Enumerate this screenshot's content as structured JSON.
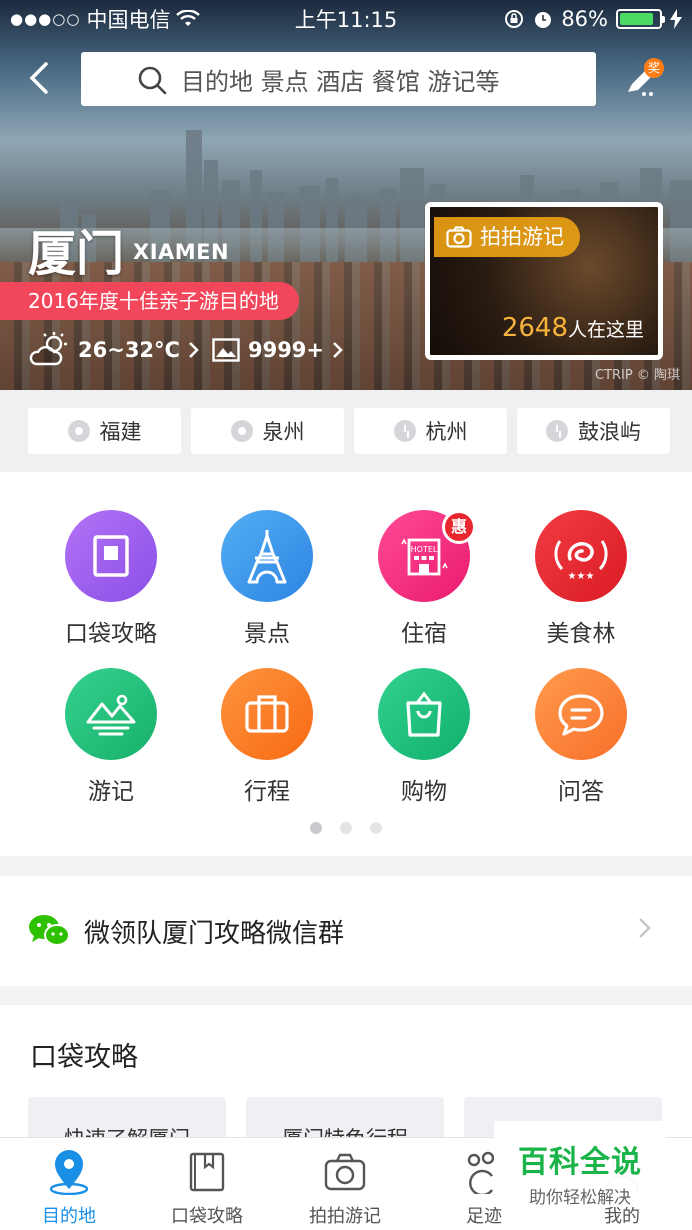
{
  "status_bar": {
    "signal": "●●●○○",
    "carrier": "中国电信",
    "time": "上午11:15",
    "battery": "86%",
    "battery_level": 0.86
  },
  "nav": {
    "search_placeholder": "目的地 景点 酒店 餐馆 游记等",
    "write_badge": "奖"
  },
  "hero": {
    "city_cn": "厦门",
    "city_en": "XIAMEN",
    "award": "2016年度十佳亲子游目的地",
    "weather": "26~32°C",
    "photo_count": "9999+",
    "copyright": "CTRIP © 陶琪",
    "photo_card": {
      "tag": "拍拍游记",
      "count": "2648",
      "count_suffix": "人在这里"
    }
  },
  "chips": [
    {
      "label": "福建",
      "icon": "pin-icon"
    },
    {
      "label": "泉州",
      "icon": "pin-icon"
    },
    {
      "label": "杭州",
      "icon": "clock-icon"
    },
    {
      "label": "鼓浪屿",
      "icon": "clock-icon"
    }
  ],
  "grid": [
    {
      "label": "口袋攻略",
      "icon": "book-icon",
      "color": "#9a5ef0"
    },
    {
      "label": "景点",
      "icon": "tower-icon",
      "color": "#3a96ea"
    },
    {
      "label": "住宿",
      "icon": "hotel-icon",
      "color": "#f42a7a",
      "badge": "惠"
    },
    {
      "label": "美食林",
      "icon": "food-forest-icon",
      "color": "#e82631"
    },
    {
      "label": "游记",
      "icon": "mountain-icon",
      "color": "#22c07a"
    },
    {
      "label": "行程",
      "icon": "suitcase-icon",
      "color": "#fb7a1e"
    },
    {
      "label": "购物",
      "icon": "bag-icon",
      "color": "#1fc07f"
    },
    {
      "label": "问答",
      "icon": "chat-icon",
      "color": "#fb7a2a"
    }
  ],
  "pager": {
    "pages": 3,
    "current": 1
  },
  "wechat_row": {
    "label": "微领队厦门攻略微信群"
  },
  "guide": {
    "title": "口袋攻略",
    "cards": [
      "快速了解厦门",
      "厦门特色行程",
      ""
    ]
  },
  "tabbar": [
    {
      "label": "目的地",
      "icon": "location-icon",
      "active": true
    },
    {
      "label": "口袋攻略",
      "icon": "book-icon",
      "active": false
    },
    {
      "label": "拍拍游记",
      "icon": "camera-icon",
      "active": false
    },
    {
      "label": "足迹",
      "icon": "footprint-icon",
      "active": false
    },
    {
      "label": "我的",
      "icon": "user-icon",
      "active": false
    }
  ],
  "watermark": {
    "title": "百科全说",
    "subtitle": "助你轻松解决"
  }
}
